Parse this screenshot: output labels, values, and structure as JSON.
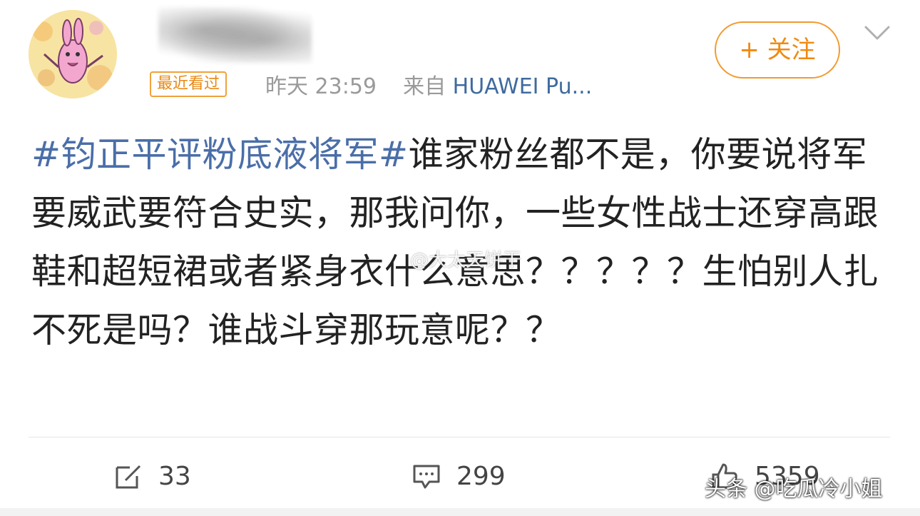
{
  "header": {
    "recent_badge": "最近看过",
    "time": "昨天 23:59",
    "source_prefix": "来自",
    "source_device": "HUAWEI Pu...",
    "follow_label": "+ 关注"
  },
  "post": {
    "hashtag": "#钧正平评粉底液将军#",
    "body": "谁家粉丝都不是，你要说将军要威武要符合史实，那我问你，一些女性战士还穿高跟鞋和超短裙或者紧身衣什么意思？？？？？生怕别人扎不死是吗？谁战斗穿那玩意呢？？"
  },
  "watermarks": {
    "center": "@大太天饼干",
    "corner": "头条 @吃瓜冷小姐"
  },
  "actions": {
    "repost_count": "33",
    "comment_count": "299",
    "like_count": "5359"
  },
  "colors": {
    "accent_orange": "#f08a10",
    "link_blue": "#4a6ea8",
    "meta_gray": "#9a9a9a"
  },
  "icons": {
    "avatar": "cartoon-rabbit-avatar",
    "menu": "chevron-down-icon",
    "repost": "repost-icon",
    "comment": "comment-icon",
    "like": "thumbs-up-icon"
  }
}
